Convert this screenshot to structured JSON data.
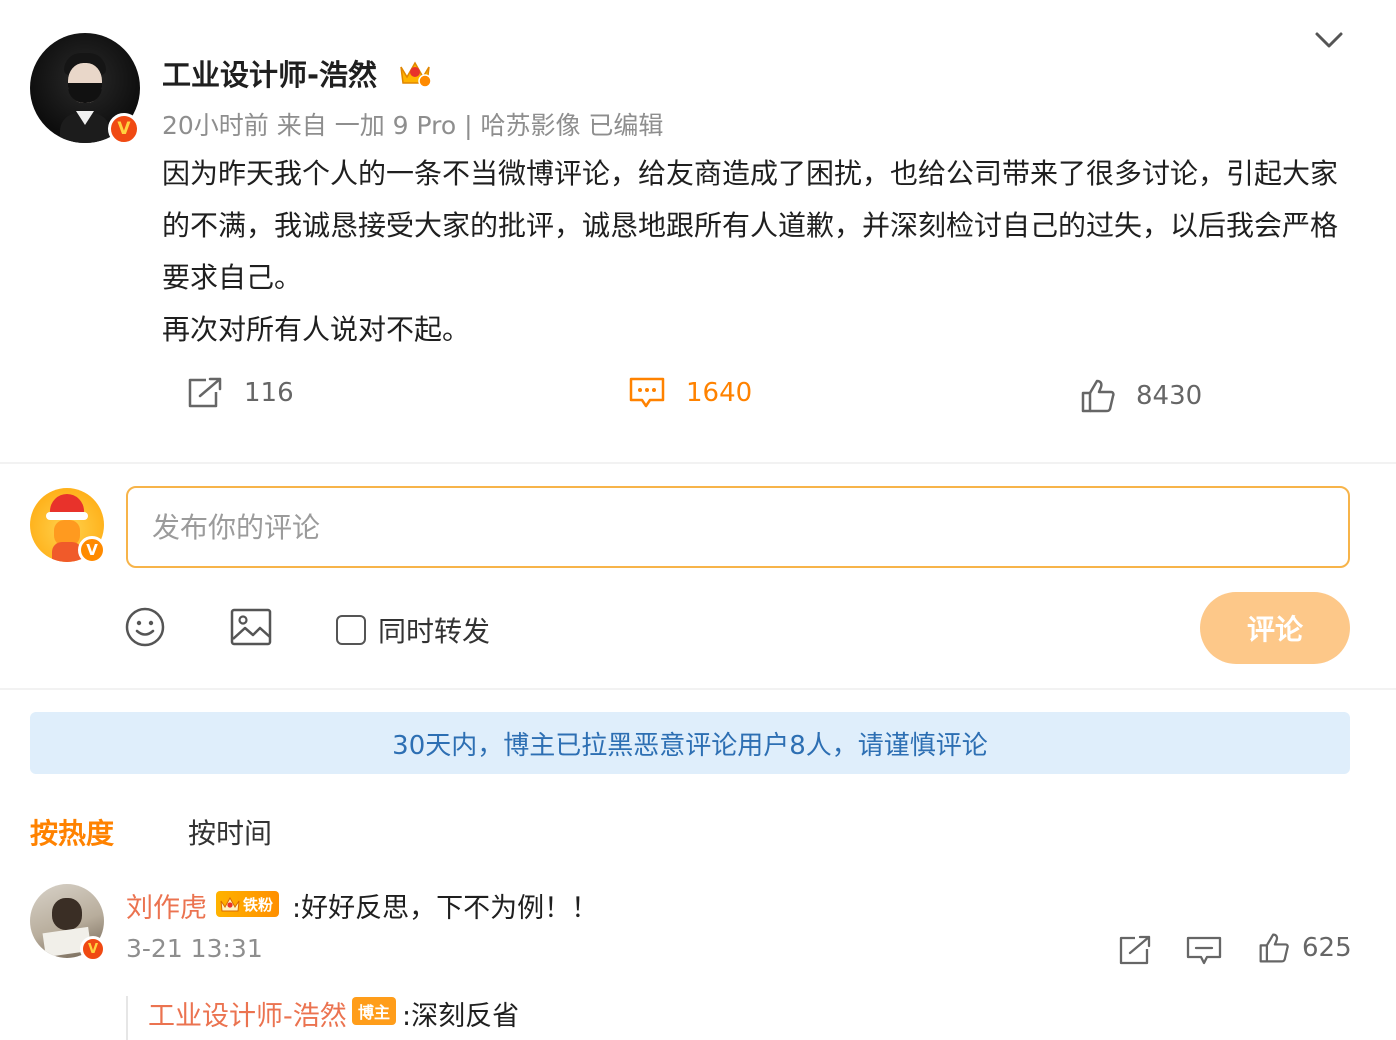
{
  "post": {
    "author_name": "工业设计师-浩然",
    "meta": "20小时前 来自 一加 9 Pro | 哈苏影像 已编辑",
    "verified_badge": "V",
    "paragraphs": [
      "因为昨天我个人的一条不当微博评论，给友商造成了困扰，也给公司带来了很多讨论，引起大家的不满，我诚恳接受大家的批评，诚恳地跟所有人道歉，并深刻检讨自己的过失，以后我会严格要求自己。",
      "再次对所有人说对不起。"
    ],
    "actions": {
      "repost_count": "116",
      "comment_count": "1640",
      "like_count": "8430"
    }
  },
  "composer": {
    "placeholder": "发布你的评论",
    "verified_badge": "V",
    "also_repost_label": "同时转发",
    "submit_label": "评论"
  },
  "notice": "30天内，博主已拉黑恶意评论用户8人，请谨慎评论",
  "sort": {
    "hot_label": "按热度",
    "time_label": "按时间"
  },
  "comments": [
    {
      "author": "刘作虎",
      "fan_badge": "铁粉",
      "text": ":好好反思，下不为例！！",
      "time": "3-21 13:31",
      "likes": "625",
      "verified_badge": "V",
      "reply": {
        "author": "工业设计师-浩然",
        "badge": "博主",
        "text": ":深刻反省"
      }
    }
  ],
  "colors": {
    "accent": "#ff8200",
    "notice_bg": "#dfeefb",
    "notice_text": "#2d6fb3",
    "name_link": "#eb7350",
    "submit_disabled": "#fdc889"
  },
  "icons": {
    "header_badge": "crown-icon",
    "collapse": "chevron-down-icon",
    "repost": "repost-icon",
    "comment": "comment-icon",
    "like": "thumbs-up-icon",
    "emoji": "smiley-icon",
    "image": "image-icon"
  }
}
